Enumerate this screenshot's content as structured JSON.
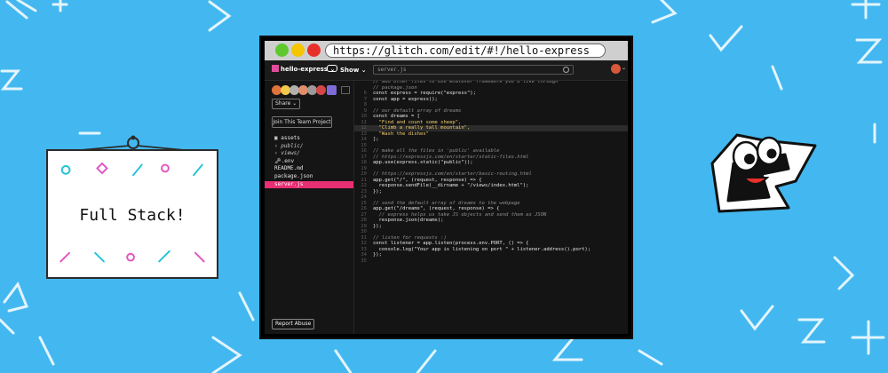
{
  "sign": {
    "title": "Full Stack!"
  },
  "browser": {
    "url": "https://glitch.com/edit/#!/hello-express"
  },
  "toolbar": {
    "project_name": "hello-express",
    "show_label": "Show",
    "file_search_value": "server.js"
  },
  "sidebar": {
    "share_label": "Share",
    "join_label": "Join This Team Project",
    "report_label": "Report Abuse",
    "files": [
      {
        "label": "assets"
      },
      {
        "label": "public/"
      },
      {
        "label": "views/"
      },
      {
        "label": ".env"
      },
      {
        "label": "README.md"
      },
      {
        "label": "package.json"
      },
      {
        "label": "server.js"
      }
    ]
  },
  "editor": {
    "lines": [
      {
        "n": "",
        "text": "// add other files to use whatever framework you'd like through"
      },
      {
        "n": "",
        "text": "// package.json"
      },
      {
        "n": "6",
        "text": "const express = require(\"express\");"
      },
      {
        "n": "7",
        "text": "const app = express();"
      },
      {
        "n": "8",
        "text": ""
      },
      {
        "n": "9",
        "text": "// our default array of dreams"
      },
      {
        "n": "10",
        "text": "const dreams = ["
      },
      {
        "n": "11",
        "text": "  \"Find and count some sheep\","
      },
      {
        "n": "12",
        "text": "  \"Climb a really tall mountain\","
      },
      {
        "n": "13",
        "text": "  \"Wash the dishes\""
      },
      {
        "n": "14",
        "text": "];"
      },
      {
        "n": "15",
        "text": ""
      },
      {
        "n": "16",
        "text": "// make all the files in 'public' available"
      },
      {
        "n": "17",
        "text": "// https://expressjs.com/en/starter/static-files.html"
      },
      {
        "n": "18",
        "text": "app.use(express.static(\"public\"));"
      },
      {
        "n": "19",
        "text": ""
      },
      {
        "n": "20",
        "text": "// https://expressjs.com/en/starter/basic-routing.html"
      },
      {
        "n": "21",
        "text": "app.get(\"/\", (request, response) => {"
      },
      {
        "n": "22",
        "text": "  response.sendFile(__dirname + \"/views/index.html\");"
      },
      {
        "n": "23",
        "text": "});"
      },
      {
        "n": "24",
        "text": ""
      },
      {
        "n": "25",
        "text": "// send the default array of dreams to the webpage"
      },
      {
        "n": "26",
        "text": "app.get(\"/dreams\", (request, response) => {"
      },
      {
        "n": "27",
        "text": "  // express helps us take JS objects and send them as JSON"
      },
      {
        "n": "28",
        "text": "  response.json(dreams);"
      },
      {
        "n": "29",
        "text": "});"
      },
      {
        "n": "30",
        "text": ""
      },
      {
        "n": "31",
        "text": "// listen for requests :)"
      },
      {
        "n": "32",
        "text": "const listener = app.listen(process.env.PORT, () => {"
      },
      {
        "n": "33",
        "text": "  console.log(\"Your app is listening on port \" + listener.address().port);"
      },
      {
        "n": "34",
        "text": "});"
      },
      {
        "n": "35",
        "text": ""
      }
    ]
  },
  "colors": {
    "background": "#43b8f0",
    "active_file": "#e72f73",
    "string": "#f5d06b",
    "comment": "#8e8e8e"
  }
}
